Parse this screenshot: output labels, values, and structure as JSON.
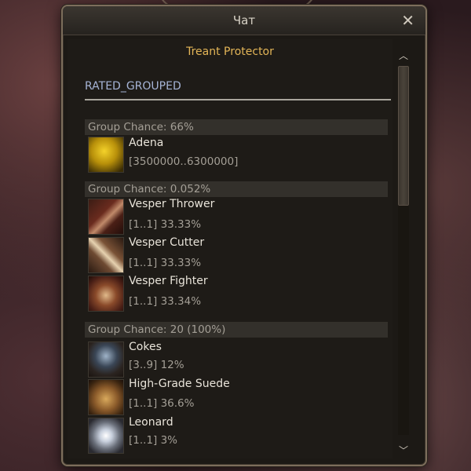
{
  "window": {
    "title": "Чат",
    "close_icon": "close-icon"
  },
  "npc": {
    "name": "Treant Protector",
    "drop_type": "RATED_GROUPED"
  },
  "groups": [
    {
      "chance": "Group Chance: 66%",
      "items": [
        {
          "name": "Adena",
          "detail": "[3500000..6300000]",
          "icon": "adena-icon"
        }
      ]
    },
    {
      "chance": "Group Chance: 0.052%",
      "items": [
        {
          "name": "Vesper Thrower",
          "detail": "[1..1] 33.33%",
          "icon": "bow-icon"
        },
        {
          "name": "Vesper Cutter",
          "detail": "[1..1] 33.33%",
          "icon": "sword-icon"
        },
        {
          "name": "Vesper Fighter",
          "detail": "[1..1] 33.34%",
          "icon": "fist-icon"
        }
      ]
    },
    {
      "chance": "Group Chance: 20 (100%)",
      "items": [
        {
          "name": "Cokes",
          "detail": "[3..9] 12%",
          "icon": "cokes-icon"
        },
        {
          "name": "High-Grade Suede",
          "detail": "[1..1] 36.6%",
          "icon": "suede-icon"
        },
        {
          "name": "Leonard",
          "detail": "[1..1] 3%",
          "icon": "leonard-icon"
        }
      ]
    }
  ],
  "colors": {
    "npc_name": "#e3b557",
    "drop_type": "#a6b4d6",
    "item_name": "#e9e4da",
    "item_detail": "#a49f96"
  }
}
